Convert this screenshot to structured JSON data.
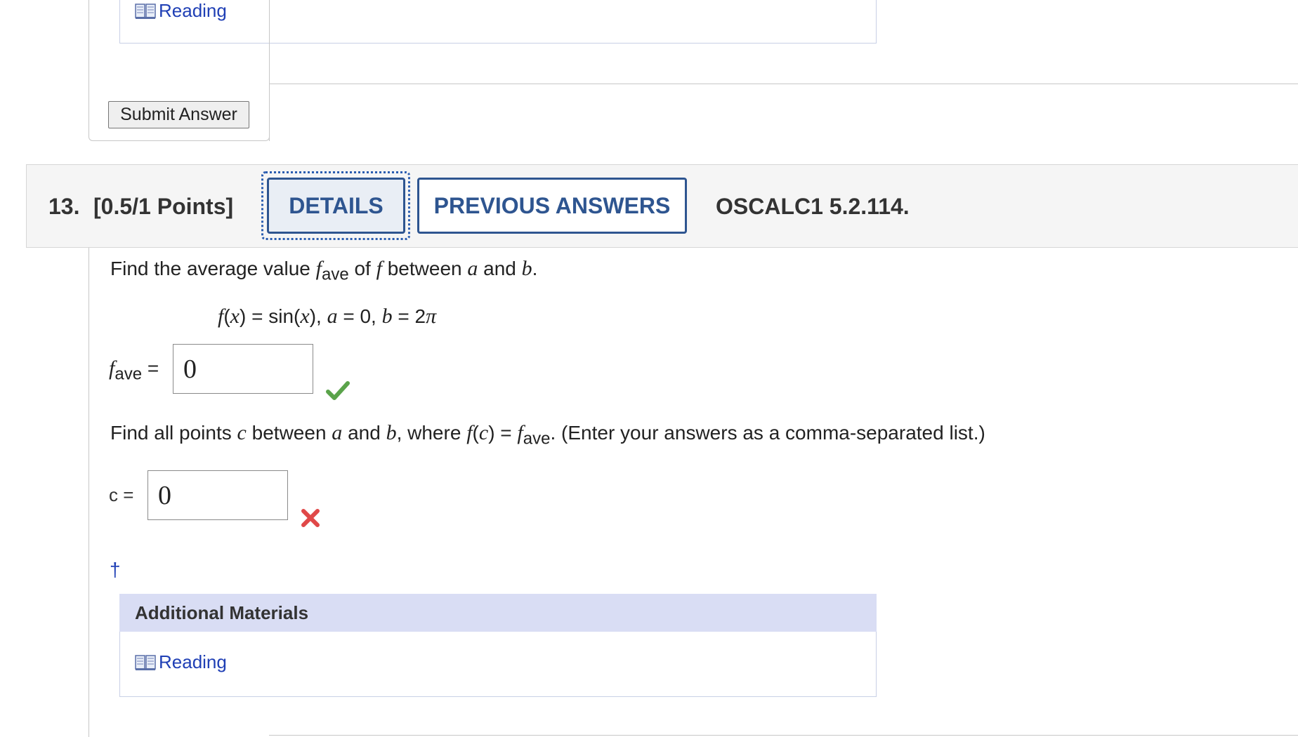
{
  "previous_question": {
    "reading_link": "Reading",
    "submit_button": "Submit Answer"
  },
  "question": {
    "number": "13.",
    "points": "[0.5/1 Points]",
    "details_button": "DETAILS",
    "previous_answers_button": "PREVIOUS ANSWERS",
    "code": "OSCALC1 5.2.114.",
    "prompt1": {
      "pre": "Find the average value ",
      "fvar": "f",
      "sub": "ave",
      "mid1": " of ",
      "f2": "f",
      "mid2": " between ",
      "a": "a",
      "mid3": " and ",
      "b": "b",
      "end": "."
    },
    "formula": {
      "f": "f",
      "lp": "(",
      "x1": "x",
      "rp": ") = sin(",
      "x2": "x",
      "rp2": "), ",
      "a": "a",
      "aval": " = 0, ",
      "b": "b",
      "bval": " = 2",
      "pi": "π"
    },
    "fave_answer": {
      "label_f": "f",
      "label_sub": "ave",
      "label_eq": " =",
      "value": "0",
      "status": "correct"
    },
    "prompt2": {
      "pre": "Find all points ",
      "c": "c",
      "mid1": " between ",
      "a": "a",
      "mid2": " and ",
      "b": "b",
      "mid3": ", where ",
      "f": "f",
      "lp": "(",
      "c2": "c",
      "rp": ") = ",
      "f2": "f",
      "sub": "ave",
      "end": ". (Enter your answers as a comma-separated list.)"
    },
    "c_answer": {
      "label": "c =",
      "value": "0",
      "status": "incorrect"
    },
    "dagger": "†",
    "additional_materials": {
      "header": "Additional Materials",
      "reading_link": "Reading"
    }
  },
  "colors": {
    "link": "#1f3fb5",
    "tab_border": "#2e5590",
    "correct": "#5aa34a",
    "incorrect": "#e04848",
    "materials_header_bg": "#d9ddf4"
  }
}
